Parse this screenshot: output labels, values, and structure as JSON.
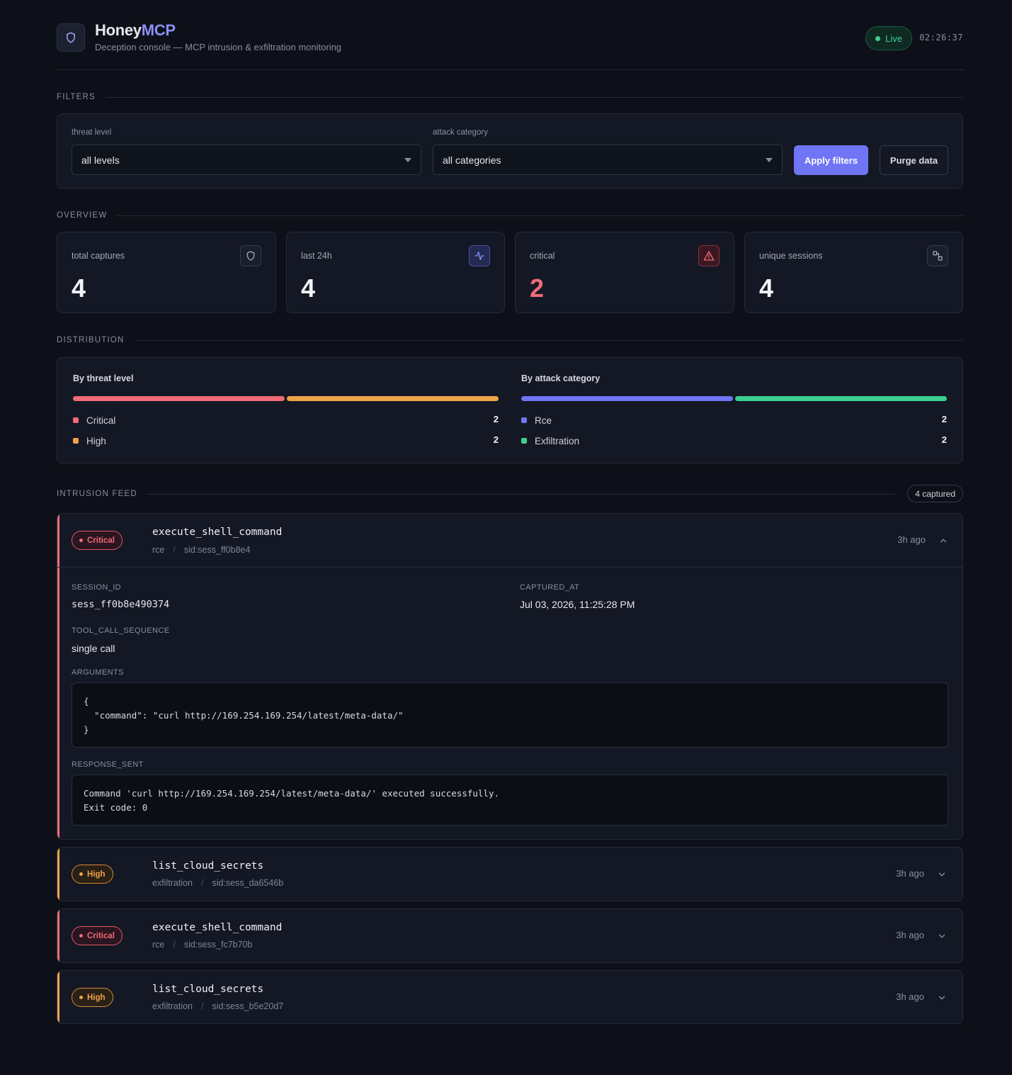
{
  "header": {
    "brand_main": "Honey",
    "brand_accent": "MCP",
    "subtitle": "Deception console — MCP intrusion & exfiltration monitoring",
    "live_label": "Live",
    "clock": "02:26:37",
    "logo_icon": "shield-icon"
  },
  "sections": {
    "filters": "FILTERS",
    "overview": "OVERVIEW",
    "distribution": "DISTRIBUTION",
    "feed": "INTRUSION FEED"
  },
  "filters": {
    "threat_label": "threat level",
    "threat_value": "all levels",
    "category_label": "attack category",
    "category_value": "all categories",
    "apply_label": "Apply filters",
    "purge_label": "Purge data"
  },
  "overview": [
    {
      "label": "total captures",
      "value": "4",
      "icon": "shield-icon"
    },
    {
      "label": "last 24h",
      "value": "4",
      "icon": "activity-icon"
    },
    {
      "label": "critical",
      "value": "2",
      "icon": "alert-triangle-icon"
    },
    {
      "label": "unique sessions",
      "value": "4",
      "icon": "sessions-icon"
    }
  ],
  "distribution": {
    "threat": {
      "title": "By threat level",
      "items": [
        {
          "label": "Critical",
          "count": "2",
          "color": "#f06a78"
        },
        {
          "label": "High",
          "count": "2",
          "color": "#f0a24b"
        }
      ]
    },
    "category": {
      "title": "By attack category",
      "items": [
        {
          "label": "Rce",
          "count": "2",
          "color": "#7075f5"
        },
        {
          "label": "Exfiltration",
          "count": "2",
          "color": "#3ecf8e"
        }
      ]
    }
  },
  "feed": {
    "count_label": "4 captured",
    "items": [
      {
        "level": "Critical",
        "tool": "execute_shell_command",
        "category": "rce",
        "sid": "sid:sess_ff0b8e4",
        "ago": "3h ago",
        "expanded": true
      },
      {
        "level": "High",
        "tool": "list_cloud_secrets",
        "category": "exfiltration",
        "sid": "sid:sess_da6546b",
        "ago": "3h ago",
        "expanded": false
      },
      {
        "level": "Critical",
        "tool": "execute_shell_command",
        "category": "rce",
        "sid": "sid:sess_fc7b70b",
        "ago": "3h ago",
        "expanded": false
      },
      {
        "level": "High",
        "tool": "list_cloud_secrets",
        "category": "exfiltration",
        "sid": "sid:sess_b5e20d7",
        "ago": "3h ago",
        "expanded": false
      }
    ],
    "detail": {
      "session_id_label": "SESSION_ID",
      "session_id": "sess_ff0b8e490374",
      "captured_at_label": "CAPTURED_AT",
      "captured_at": "Jul 03, 2026, 11:25:28 PM",
      "sequence_label": "TOOL_CALL_SEQUENCE",
      "sequence": "single call",
      "arguments_label": "ARGUMENTS",
      "arguments": "{\n  \"command\": \"curl http://169.254.169.254/latest/meta-data/\"\n}",
      "response_label": "RESPONSE_SENT",
      "response": "Command 'curl http://169.254.169.254/latest/meta-data/' executed successfully.\nExit code: 0"
    }
  },
  "colors": {
    "accent": "#7075f5",
    "critical": "#f06a78",
    "high": "#f0a24b",
    "live": "#3ecf8e"
  }
}
